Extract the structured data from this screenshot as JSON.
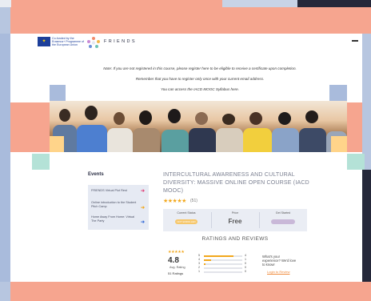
{
  "header": {
    "eu_text": "Co-funded by the Erasmus+ Programme of the European Union",
    "brand": "FRIENDS"
  },
  "notes": {
    "note1": "Note: If you are not registered in this course, please register here to be eligible to receive a certificate upon completion.",
    "note2": "Remember that you have to register only once with your current email address.",
    "note3": "You can access the IACD MOOC Syllabus here."
  },
  "events": {
    "title": "Events",
    "items": [
      {
        "label": "FRIENDS Virtual Plot Rest",
        "arrow_color": "#e0457b"
      },
      {
        "label": "Online introduction to the Student Pitch Camp",
        "arrow_color": "#f2a81d"
      },
      {
        "label": "Home Away From Home: Virtual The Party",
        "arrow_color": "#3a6fd8"
      }
    ]
  },
  "course": {
    "title": "INTERCULTURAL AWARENESS AND CULTURAL DIVERSITY: MASSIVE ONLINE OPEN COURSE (IACD MOOC)",
    "stars": "★★★★★",
    "review_count": "(51)",
    "info": {
      "status_label": "Current Status",
      "status_value": "NOT ENROLLED",
      "price_label": "Price",
      "price_value": "Free",
      "start_label": "Get Started"
    }
  },
  "ratings": {
    "title": "RATINGS AND REVIEWS",
    "stars": "★★★★★",
    "average": "4.8",
    "average_label": "Avg. Rating",
    "count_text": "51 Ratings",
    "bars": [
      {
        "stars": "5",
        "fraction": 0.78,
        "count": "4"
      },
      {
        "stars": "4",
        "fraction": 0.18,
        "count": "1"
      },
      {
        "stars": "3",
        "fraction": 0.04,
        "count": "0"
      },
      {
        "stars": "2",
        "fraction": 0.0,
        "count": "0"
      },
      {
        "stars": "1",
        "fraction": 0.0,
        "count": "0"
      }
    ],
    "prompt": "What's your experience? We'd love to know!",
    "login_link": "Login to Review"
  }
}
